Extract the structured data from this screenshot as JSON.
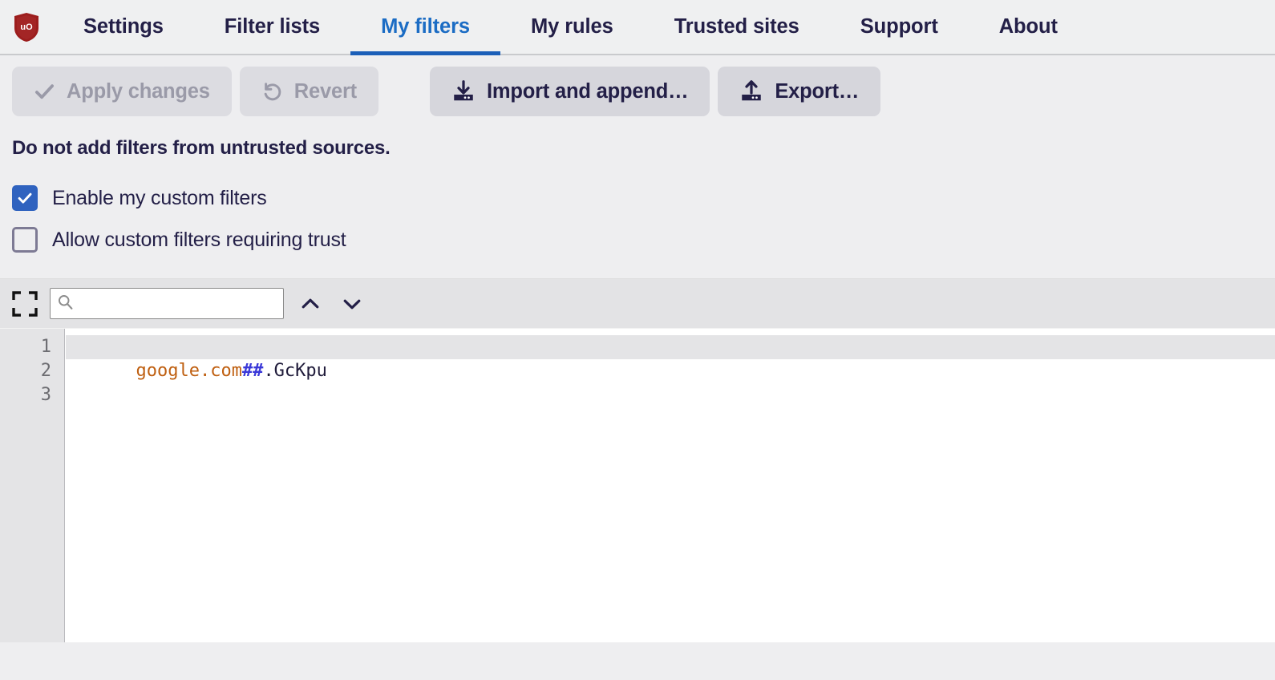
{
  "app": {
    "logo_icon": "ublock-origin-shield-icon",
    "logo_text": "uO",
    "logo_color": "#9c1d1d"
  },
  "tabs": [
    {
      "label": "Settings",
      "name": "tab-settings",
      "active": false
    },
    {
      "label": "Filter lists",
      "name": "tab-filter-lists",
      "active": false
    },
    {
      "label": "My filters",
      "name": "tab-my-filters",
      "active": true
    },
    {
      "label": "My rules",
      "name": "tab-my-rules",
      "active": false
    },
    {
      "label": "Trusted sites",
      "name": "tab-trusted-sites",
      "active": false
    },
    {
      "label": "Support",
      "name": "tab-support",
      "active": false
    },
    {
      "label": "About",
      "name": "tab-about",
      "active": false
    }
  ],
  "toolbar": {
    "apply_label": "Apply changes",
    "apply_icon": "check-icon",
    "apply_disabled": true,
    "revert_label": "Revert",
    "revert_icon": "undo-arrow-icon",
    "revert_disabled": true,
    "import_label": "Import and append…",
    "import_icon": "import-download-tray-icon",
    "export_label": "Export…",
    "export_icon": "export-upload-tray-icon"
  },
  "warning": {
    "text": "Do not add filters from untrusted sources."
  },
  "options": [
    {
      "label": "Enable my custom filters",
      "checked": true,
      "name": "checkbox-enable-my-custom-filters"
    },
    {
      "label": "Allow custom filters requiring trust",
      "checked": false,
      "name": "checkbox-allow-custom-filters-requiring-trust"
    }
  ],
  "editor_toolbar": {
    "expand_icon": "expand-fullscreen-icon",
    "search_value": "",
    "search_placeholder": "",
    "search_icon": "search-magnifier-icon",
    "prev_icon": "chevron-up-icon",
    "next_icon": "chevron-down-icon"
  },
  "editor": {
    "line_numbers": [
      "1",
      "2",
      "3"
    ],
    "active_line": 1,
    "lines": [
      {
        "tokens": [
          {
            "text": "google.com",
            "type": "host"
          },
          {
            "text": "##",
            "type": "separator"
          },
          {
            "text": ".GcKpu",
            "type": "selector"
          }
        ]
      },
      {
        "tokens": []
      },
      {
        "tokens": []
      }
    ],
    "colors": {
      "host": "#bf5f10",
      "separator": "#3b39d8",
      "selector": "#1f1b3a"
    }
  }
}
